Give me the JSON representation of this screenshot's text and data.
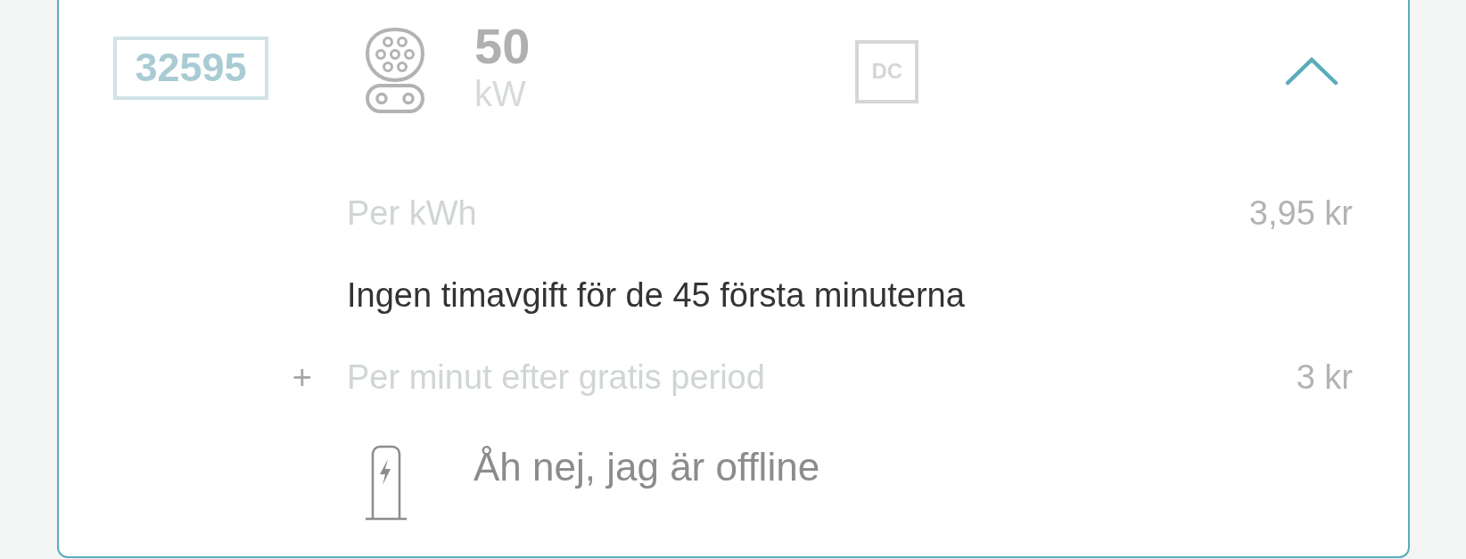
{
  "connector": {
    "number": "32595",
    "power": "50",
    "unit": "kW",
    "current_type": "DC",
    "expanded": true
  },
  "prices": [
    {
      "kind": "price",
      "label": "Per kWh",
      "value": "3,95 kr"
    },
    {
      "kind": "note",
      "text": "Ingen timavgift för de 45 första minuterna"
    },
    {
      "kind": "price",
      "prefix": "+",
      "label": "Per minut efter gratis period",
      "value": "3 kr"
    }
  ],
  "status": {
    "message": "Åh nej, jag är offline"
  }
}
